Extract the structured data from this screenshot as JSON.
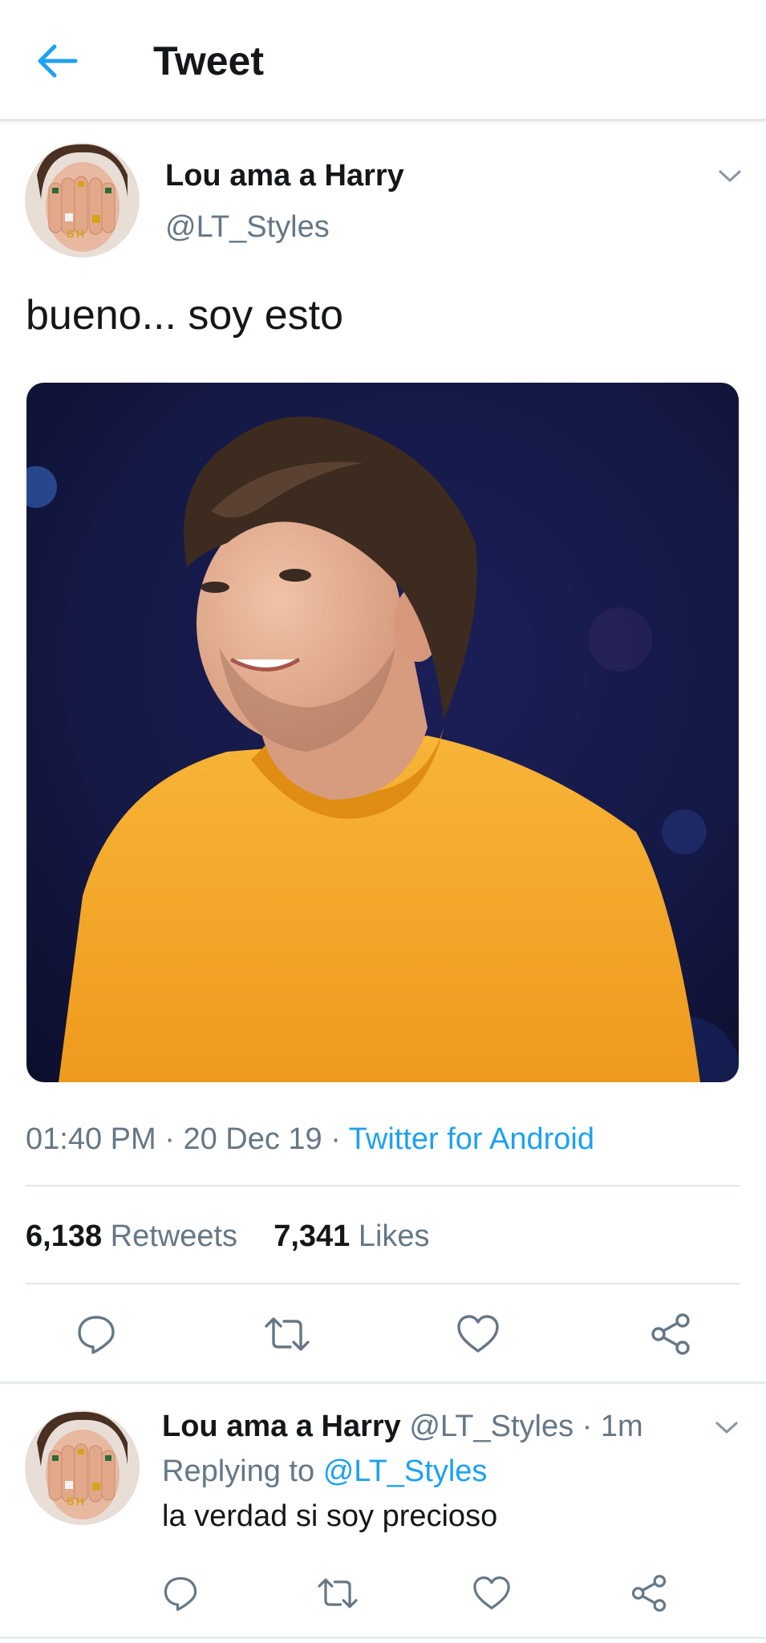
{
  "header": {
    "title": "Tweet"
  },
  "tweet": {
    "author_name": "Lou ama a Harry",
    "author_handle": "@LT_Styles",
    "text": "bueno... soy esto",
    "time": "01:40 PM",
    "date": "20 Dec 19",
    "separator": "·",
    "source": "Twitter for Android",
    "retweets_count": "6,138",
    "retweets_label": "Retweets",
    "likes_count": "7,341",
    "likes_label": "Likes"
  },
  "reply": {
    "author_name": "Lou ama a Harry",
    "author_handle": "@LT_Styles",
    "separator": "·",
    "age": "1m",
    "replying_prefix": "Replying to",
    "replying_handle": "@LT_Styles",
    "text": "la verdad si soy precioso"
  },
  "colors": {
    "accent": "#1da1f2",
    "muted": "#657786",
    "text": "#14171a",
    "divider": "#e1e8ed",
    "sweater": "#f4a62a"
  },
  "icons": {
    "back": "arrow-left-icon",
    "more": "chevron-down-icon",
    "reply": "comment-icon",
    "retweet": "retweet-icon",
    "like": "heart-icon",
    "share": "share-icon"
  }
}
